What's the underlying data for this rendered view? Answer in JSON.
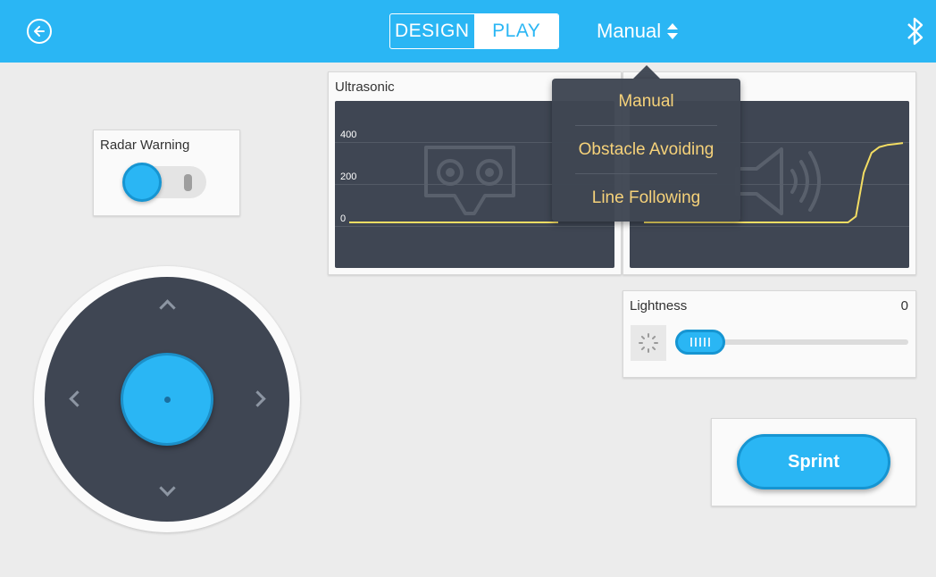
{
  "header": {
    "back_icon": "back-arrow-icon",
    "tabs": [
      {
        "label": "DESIGN",
        "selected": false
      },
      {
        "label": "PLAY",
        "selected": true
      }
    ],
    "mode": {
      "label": "Manual",
      "icon": "sort-updown-icon"
    },
    "bluetooth_icon": "bluetooth-icon",
    "accent_color": "#2ab6f4"
  },
  "mode_dropdown": {
    "items": [
      "Manual",
      "Obstacle Avoiding",
      "Line Following"
    ],
    "text_color": "#f6d27a"
  },
  "radar_card": {
    "title": "Radar Warning",
    "toggle_on": true
  },
  "joystick": {
    "arrows": [
      "up",
      "down",
      "left",
      "right"
    ]
  },
  "ultrasonic_card": {
    "title": "Ultrasonic",
    "icon": "vr-glasses-icon",
    "chart_data": {
      "type": "line",
      "title": "Ultrasonic",
      "ylim": [
        0,
        400
      ],
      "y_ticks": [
        "400",
        "200",
        "0"
      ],
      "series": [
        {
          "values": [
            0,
            0,
            0,
            0,
            0,
            0,
            0,
            0,
            0,
            0
          ]
        }
      ]
    }
  },
  "sound_card": {
    "icon": "speaker-icon",
    "chart_data": {
      "type": "line",
      "ylim": [
        0,
        450
      ],
      "series": [
        {
          "values": [
            0,
            0,
            0,
            0,
            0,
            0,
            0,
            0,
            0,
            0,
            0,
            0,
            0,
            0,
            0,
            0,
            0,
            0,
            0,
            0,
            0,
            0,
            0,
            0,
            0,
            0,
            0,
            30,
            250,
            350,
            380,
            390,
            395,
            400
          ]
        }
      ]
    }
  },
  "lightness_card": {
    "title": "Lightness",
    "value": "0",
    "level": 0,
    "icon": "sun-loading-icon"
  },
  "sprint": {
    "label": "Sprint"
  }
}
